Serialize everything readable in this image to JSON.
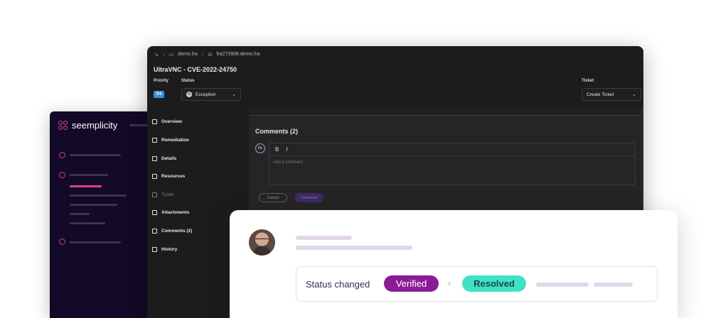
{
  "sidebar": {
    "brand": "seemplicity"
  },
  "window": {
    "breadcrumb": [
      "demo.fra",
      "fra273908.demo.fra"
    ],
    "title": "UltraVNC - CVE-2022-24750",
    "priority_label": "Priority",
    "priority_value": "P4",
    "status_label": "Status",
    "status_value": "Exception",
    "ticket_label": "Ticket",
    "ticket_value": "Create Ticket",
    "nav": [
      "Overview",
      "Remediation",
      "Details",
      "Resources",
      "Ticket",
      "Attachments",
      "Comments (2)",
      "History"
    ],
    "comments_title": "Comments (2)",
    "commenter_initials": "KE",
    "editor_bold": "B",
    "editor_italic": "I",
    "comment_placeholder": "Add a comment...",
    "cancel_label": "Cancel",
    "comment_label": "Comment"
  },
  "card": {
    "status_text": "Status changed",
    "from_status": "Verified",
    "to_status": "Resolved",
    "colors": {
      "verified": "#8a1c96",
      "resolved": "#3fe2c5"
    }
  }
}
